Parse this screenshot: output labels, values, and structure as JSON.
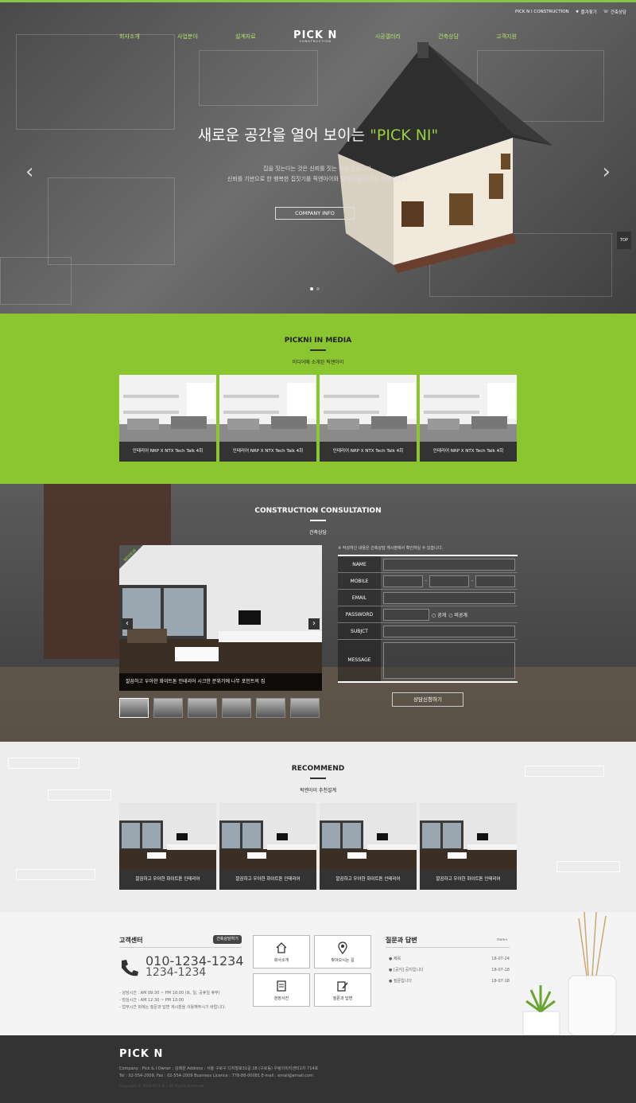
{
  "utility": {
    "company": "PICK N I CONSTRUCTION",
    "bookmark": "즐겨찾기",
    "consult": "건축상담"
  },
  "nav": {
    "items": [
      "회사소개",
      "사업분야",
      "설계자료",
      "시공갤러리",
      "건축상담",
      "고객지원"
    ],
    "logo": "PICK N",
    "logo_sub": "CONSTRUCTION"
  },
  "hero": {
    "title_prefix": "새로운 공간을 열어 보이는 ",
    "title_highlight": "\"PICK NI\"",
    "sub1": "집을 짓는다는 것은 신뢰를 짓는 것과 같습니다.",
    "sub2": "신뢰를 기반으로 한 행복한 집짓기를 픽엔아이와 함께 만들어 가는 비법입니다.",
    "button": "COMPANY INFO",
    "prev": "‹",
    "next": "›",
    "top": "TOP"
  },
  "media": {
    "title": "PICKNI IN MEDIA",
    "subtitle": "미디어에 소개된 픽엔아이",
    "cards": [
      "인테리어 NRP X NTX Tech Talk 4회",
      "인테리어 NRP X NTX Tech Talk 4회",
      "인테리어 NRP X NTX Tech Talk 4회",
      "인테리어 NRP X NTX Tech Talk 4회"
    ]
  },
  "consult": {
    "title": "CONSTRUCTION CONSULTATION",
    "subtitle": "건축상담",
    "badge": "REVIEW",
    "gallery_caption": "깔끔하고 우아한 화이트톤 인테리어 시크한 분위기에 나무 포인트의 집",
    "note": "※ 작성하신 내용은 건축상담 게시판에서 확인하실 수 있습니다.",
    "labels": {
      "name": "NAME",
      "mobile": "MOBILE",
      "email": "EMAIL",
      "password": "PASSWORD",
      "subject": "SUBJCT",
      "message": "MESSAGE"
    },
    "dash": "-",
    "public": "공개",
    "private": "비공개",
    "submit": "상담신청하기"
  },
  "recommend": {
    "title": "RECOMMEND",
    "subtitle": "픽엔아이 추천설계",
    "cards": [
      "깔끔하고 우아한 화이트톤 인테리어",
      "깔끔하고 우아한 화이트톤 인테리어",
      "깔끔하고 우아한 화이트톤 인테리어",
      "깔끔하고 우아한 화이트톤 인테리어"
    ]
  },
  "cs": {
    "title": "고객센터",
    "button": "건축상담하기",
    "phone1": "010-1234-1234",
    "phone2": "1234-1234",
    "hours": [
      "- 상담시간 : AM 09:30 ~ PM 18:00 (토, 일, 공휴일 휴무)",
      "- 점심시간 : AM 12:30 ~ PM 13:00",
      "- 업무시간 외에는 질문과 답변 게시판을 이용해주시기 바랍니다."
    ]
  },
  "quick": [
    "회사소개",
    "찾아오시는 길",
    "현장사진",
    "질문과 답변"
  ],
  "qna": {
    "title": "질문과 답변",
    "more": "more+",
    "items": [
      {
        "t": "● 제목",
        "d": "18-07-24"
      },
      {
        "t": "● [공지] 공지입니다",
        "d": "18-07-18"
      },
      {
        "t": "● 질문입니다",
        "d": "18-07-18"
      }
    ]
  },
  "footer": {
    "logo": "PICK N",
    "line1": "Company : Pick & I Owner : 김제원 Address : 서울 구로구 디지털로31길 28 (구로동) 우림이비지센터1차 714호",
    "line2": "Tel : 02-554-2009, Fax : 02-554-2009 Business Licence : 778-88-00081 E-mail : email@email.com",
    "copy": "Copyright © 2018 PICK N I. All Rights Reserved."
  },
  "colors": {
    "accent": "#8bc631",
    "dark": "#333333"
  }
}
